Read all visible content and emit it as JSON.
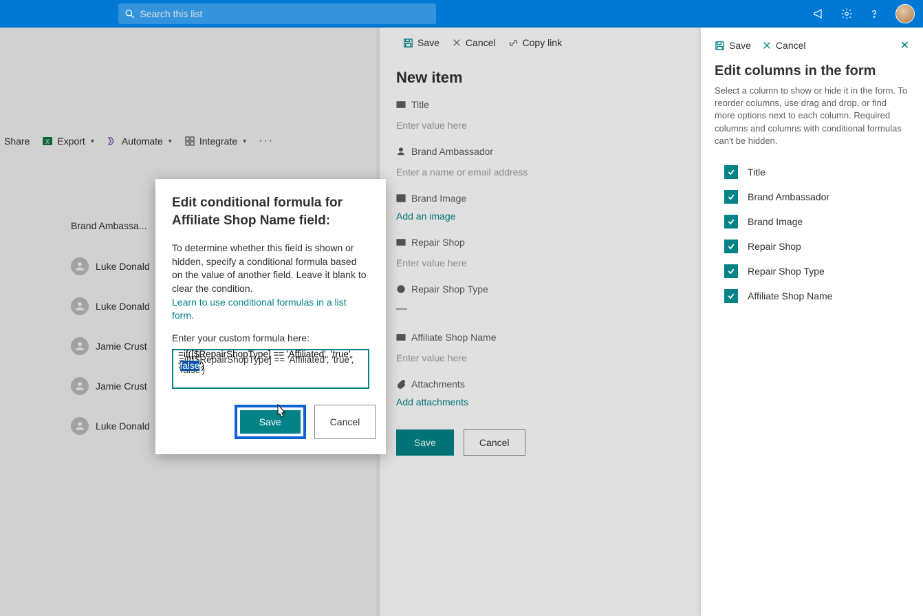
{
  "topbar": {
    "search_placeholder": "Search this list"
  },
  "cmdbar": {
    "share": "Share",
    "export": "Export",
    "automate": "Automate",
    "integrate": "Integrate"
  },
  "bg_list": {
    "header": "Brand Ambassa...",
    "rows": [
      "Luke Donald",
      "Luke Donald",
      "Jamie Crust",
      "Jamie Crust",
      "Luke Donald"
    ]
  },
  "mid": {
    "cmd": {
      "save": "Save",
      "cancel": "Cancel",
      "copylink": "Copy link"
    },
    "title": "New item",
    "fields": {
      "title": {
        "label": "Title",
        "placeholder": "Enter value here"
      },
      "ambassador": {
        "label": "Brand Ambassador",
        "placeholder": "Enter a name or email address"
      },
      "image": {
        "label": "Brand Image",
        "link": "Add an image"
      },
      "shop": {
        "label": "Repair Shop",
        "placeholder": "Enter value here"
      },
      "shoptype": {
        "label": "Repair Shop Type",
        "value": "—"
      },
      "affshop": {
        "label": "Affiliate Shop Name",
        "placeholder": "Enter value here"
      },
      "attach": {
        "label": "Attachments",
        "link": "Add attachments"
      }
    },
    "actions": {
      "save": "Save",
      "cancel": "Cancel"
    }
  },
  "right": {
    "save": "Save",
    "cancel": "Cancel",
    "title": "Edit columns in the form",
    "desc": "Select a column to show or hide it in the form. To reorder columns, use drag and drop, or find more options next to each column. Required columns and columns with conditional formulas can't be hidden.",
    "cols": [
      "Title",
      "Brand Ambassador",
      "Brand Image",
      "Repair Shop",
      "Repair Shop Type",
      "Affiliate Shop Name"
    ]
  },
  "modal": {
    "title": "Edit conditional formula for Affiliate Shop Name field:",
    "desc": "To determine whether this field is shown or hidden, specify a conditional formula based on the value of another field. Leave it blank to clear the condition.",
    "link": "Learn to use conditional formulas in a list form.",
    "input_label": "Enter your custom formula here:",
    "formula_pre": "=if([$RepairShopType] == 'Affiliated', 'true', '",
    "formula_hl": "false",
    "formula_post": "')",
    "formula_full": "=if([$RepairShopType] == 'Affiliated', 'true', 'false')",
    "save": "Save",
    "cancel": "Cancel"
  }
}
